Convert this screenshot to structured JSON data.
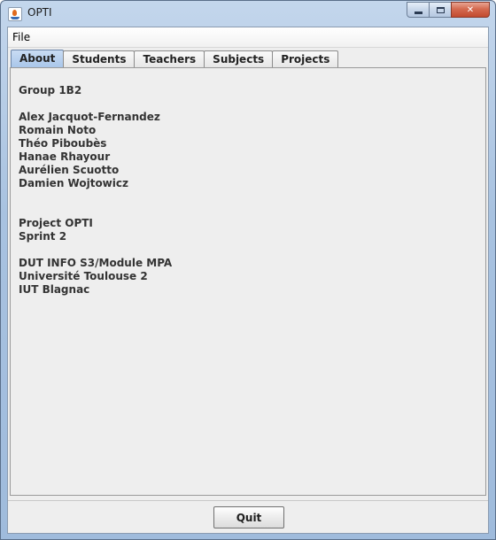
{
  "window": {
    "title": "OPTI",
    "icon": "java-cup-icon",
    "controls": {
      "minimize_icon": "minimize-icon",
      "maximize_icon": "maximize-icon",
      "close_label": "✕"
    }
  },
  "menubar": {
    "items": [
      {
        "label": "File"
      }
    ]
  },
  "tabs": [
    {
      "label": "About",
      "active": true
    },
    {
      "label": "Students",
      "active": false
    },
    {
      "label": "Teachers",
      "active": false
    },
    {
      "label": "Subjects",
      "active": false
    },
    {
      "label": "Projects",
      "active": false
    }
  ],
  "about": {
    "group": "Group 1B2",
    "members": [
      "Alex Jacquot-Fernandez",
      "Romain Noto",
      "Théo Piboubès",
      "Hanae Rhayour",
      "Aurélien Scuotto",
      "Damien Wojtowicz"
    ],
    "project": "Project OPTI",
    "sprint": "Sprint 2",
    "course": "DUT INFO S3/Module MPA",
    "university": "Université Toulouse 2",
    "institute": "IUT Blagnac"
  },
  "footer": {
    "quit_label": "Quit"
  },
  "colors": {
    "active_tab": "#b6cfee",
    "frame": "#a8c2e0",
    "panel": "#eeeeee",
    "close_button": "#c9553a"
  }
}
